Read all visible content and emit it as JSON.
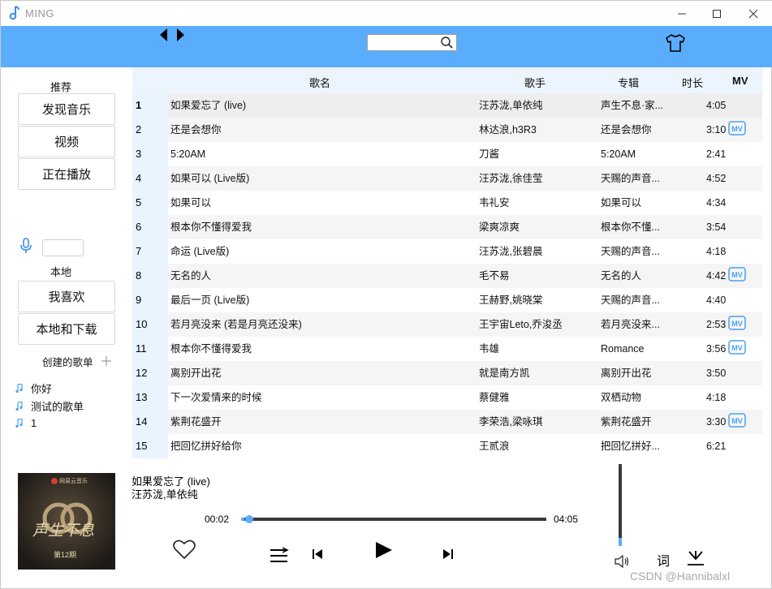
{
  "app": {
    "title": "MING"
  },
  "sidebar": {
    "recommend_label": "推荐",
    "recommend_items": [
      "发现音乐",
      "视频",
      "正在播放"
    ],
    "local_label": "本地",
    "local_items": [
      "我喜欢",
      "本地和下载"
    ],
    "created_label": "创建的歌单",
    "playlists": [
      "你好",
      "测试的歌单",
      "1"
    ]
  },
  "table": {
    "headers": {
      "title": "歌名",
      "artist": "歌手",
      "album": "专辑",
      "duration": "时长",
      "mv": "MV"
    },
    "rows": [
      {
        "idx": "1",
        "title": "如果爱忘了 (live)",
        "artist": "汪苏泷,单依纯",
        "album": "声生不息·家...",
        "duration": "4:05",
        "mv": false
      },
      {
        "idx": "2",
        "title": "还是会想你",
        "artist": "林达浪,h3R3",
        "album": "还是会想你",
        "duration": "3:10",
        "mv": true
      },
      {
        "idx": "3",
        "title": "5:20AM",
        "artist": "刀酱",
        "album": "5:20AM",
        "duration": "2:41",
        "mv": false
      },
      {
        "idx": "4",
        "title": "如果可以 (Live版)",
        "artist": "汪苏泷,徐佳莹",
        "album": "天赐的声音...",
        "duration": "4:52",
        "mv": false
      },
      {
        "idx": "5",
        "title": "如果可以",
        "artist": "韦礼安",
        "album": "如果可以",
        "duration": "4:34",
        "mv": false
      },
      {
        "idx": "6",
        "title": "根本你不懂得爱我",
        "artist": "梁爽凉爽",
        "album": "根本你不懂...",
        "duration": "3:54",
        "mv": false
      },
      {
        "idx": "7",
        "title": "命运 (Live版)",
        "artist": "汪苏泷,张碧晨",
        "album": "天赐的声音...",
        "duration": "4:18",
        "mv": false
      },
      {
        "idx": "8",
        "title": "无名的人",
        "artist": "毛不易",
        "album": "无名的人",
        "duration": "4:42",
        "mv": true
      },
      {
        "idx": "9",
        "title": "最后一页 (Live版)",
        "artist": "王赫野,姚晓棠",
        "album": "天赐的声音...",
        "duration": "4:40",
        "mv": false
      },
      {
        "idx": "10",
        "title": "若月亮没来 (若是月亮还没来)",
        "artist": "王宇宙Leto,乔浚丞",
        "album": "若月亮没来...",
        "duration": "2:53",
        "mv": true
      },
      {
        "idx": "11",
        "title": "根本你不懂得爱我",
        "artist": "韦雄",
        "album": "Romance",
        "duration": "3:56",
        "mv": true
      },
      {
        "idx": "12",
        "title": "离别开出花",
        "artist": "就是南方凯",
        "album": "离别开出花",
        "duration": "3:50",
        "mv": false
      },
      {
        "idx": "13",
        "title": "下一次爱情来的时候",
        "artist": "蔡健雅",
        "album": "双栖动物",
        "duration": "4:18",
        "mv": false
      },
      {
        "idx": "14",
        "title": "紫荆花盛开",
        "artist": "李荣浩,梁咏琪",
        "album": "紫荆花盛开",
        "duration": "3:30",
        "mv": true
      },
      {
        "idx": "15",
        "title": "把回忆拼好给你",
        "artist": "王贰浪",
        "album": "把回忆拼好...",
        "duration": "6:21",
        "mv": false
      }
    ],
    "mv_badge_text": "MV"
  },
  "player": {
    "title": "如果爱忘了 (live)",
    "artist": "汪苏泷,单依纯",
    "current_time": "00:02",
    "total_time": "04:05",
    "progress": 0.01,
    "volume": 0.1,
    "lyric_label": "词",
    "cover": {
      "brand": "网易云音乐",
      "title": "声生不息",
      "episode": "第12期"
    }
  },
  "watermark": "CSDN @Hannibalxl",
  "colors": {
    "accent": "#5aadfc",
    "header_bg": "#5aadfc",
    "index_bg": "#e9f4fe",
    "stripe": "#f5f5f5"
  }
}
